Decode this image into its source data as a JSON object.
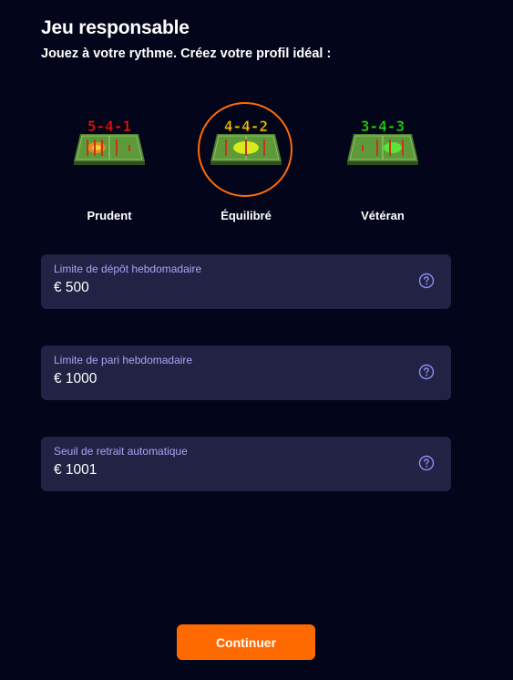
{
  "header": {
    "title": "Jeu responsable",
    "subtitle": "Jouez à votre rythme. Créez votre profil idéal :"
  },
  "profiles": [
    {
      "formation": "5-4-1",
      "label": "Prudent",
      "color": "#e8121b",
      "selected": false
    },
    {
      "formation": "4-4-2",
      "label": "Équilibré",
      "color": "#f5c400",
      "selected": true
    },
    {
      "formation": "3-4-3",
      "label": "Vétéran",
      "color": "#2fd41a",
      "selected": false
    }
  ],
  "limits": [
    {
      "label": "Limite de dépôt hebdomadaire",
      "value": "€ 500",
      "icon": "help-circle-icon"
    },
    {
      "label": "Limite de pari hebdomadaire",
      "value": "€ 1000",
      "icon": "help-circle-icon"
    },
    {
      "label": "Seuil de retrait automatique",
      "value": "€ 1001",
      "icon": "help-circle-icon"
    }
  ],
  "actions": {
    "continue_label": "Continuer"
  },
  "colors": {
    "background": "#03051a",
    "card": "#212244",
    "label": "#a7a6f4",
    "accent": "#ff6a00",
    "ring": "#ff6b07"
  }
}
